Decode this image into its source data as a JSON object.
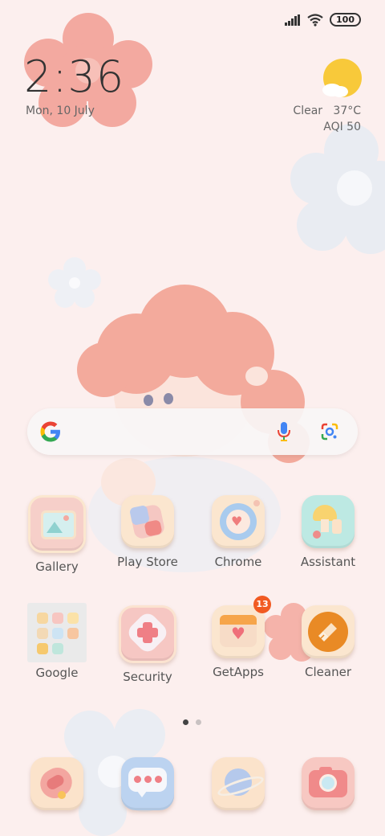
{
  "status_bar": {
    "battery": "100"
  },
  "clock": {
    "time": "2:36",
    "date": "Mon, 10 July"
  },
  "weather": {
    "condition": "Clear",
    "temperature": "37°C",
    "aqi": "AQI 50"
  },
  "search_bar": {
    "google_letter": "G"
  },
  "apps_row1": [
    {
      "label": "Gallery"
    },
    {
      "label": "Play Store"
    },
    {
      "label": "Chrome"
    },
    {
      "label": "Assistant"
    }
  ],
  "apps_row2": [
    {
      "label": "Google"
    },
    {
      "label": "Security"
    },
    {
      "label": "GetApps",
      "badge": "13"
    },
    {
      "label": "Cleaner"
    }
  ],
  "dock": [
    {
      "icon": "phone-icon"
    },
    {
      "icon": "messages-icon"
    },
    {
      "icon": "browser-icon"
    },
    {
      "icon": "camera-icon"
    }
  ],
  "page_indicator": {
    "pages": 2,
    "current": 1
  },
  "colors": {
    "background": "#fcefee",
    "badge": "#f15a22",
    "accent_orange": "#e98a25"
  }
}
